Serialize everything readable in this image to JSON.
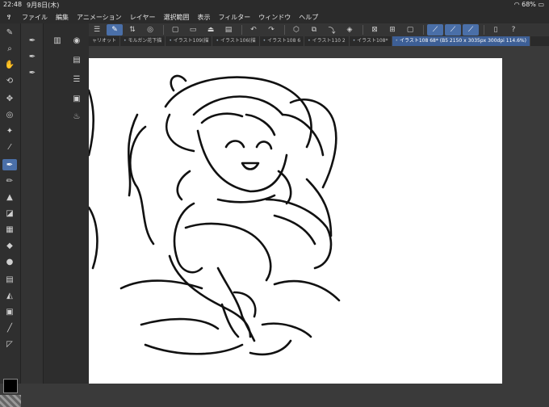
{
  "status": {
    "time": "22:48",
    "date": "9月8日(木)",
    "battery": "68%"
  },
  "menu": {
    "items": [
      "ファイル",
      "編集",
      "アニメーション",
      "レイヤー",
      "選択範囲",
      "表示",
      "フィルター",
      "ウィンドウ",
      "ヘルプ"
    ]
  },
  "tabs": [
    {
      "label": "ャリオット"
    },
    {
      "label": "モルガン花下描"
    },
    {
      "label": "イラスト109(描"
    },
    {
      "label": "イラスト106(描"
    },
    {
      "label": "イラスト108 6"
    },
    {
      "label": "イラスト110 2"
    },
    {
      "label": "イラスト108*"
    },
    {
      "label": "イラスト108 68* (B5 2150 x 3035px 300dpi 114.6%)"
    }
  ],
  "colors": {
    "accent": "#4a6fa8",
    "active_tab": "#3d5f96",
    "main_color": "#000000"
  }
}
